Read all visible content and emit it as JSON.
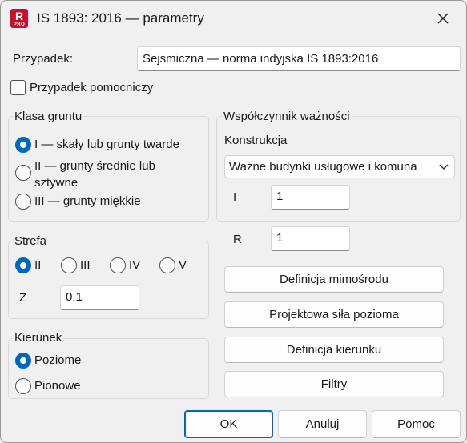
{
  "window": {
    "title": "IS 1893: 2016 — parametry",
    "app_icon_letter": "R",
    "app_icon_sub": "PRO"
  },
  "case": {
    "label": "Przypadek:",
    "value": "Sejsmiczna — norma indyjska IS 1893:2016",
    "aux_label": "Przypadek pomocniczy",
    "aux_checked": false
  },
  "soil_class": {
    "title": "Klasa gruntu",
    "options": [
      {
        "label": "I — skały lub grunty twarde",
        "selected": true
      },
      {
        "label_line1": "II — grunty średnie lub",
        "label_line2": "sztywne",
        "selected": false
      },
      {
        "label": "III — grunty miękkie",
        "selected": false
      }
    ]
  },
  "importance": {
    "title": "Współczynnik ważności",
    "construction_label": "Konstrukcja",
    "construction_value": "Ważne budynki usługowe i komuna",
    "i_label": "I",
    "i_value": "1"
  },
  "r": {
    "label": "R",
    "value": "1"
  },
  "zone": {
    "title": "Strefa",
    "options": [
      {
        "label": "II",
        "selected": true
      },
      {
        "label": "III",
        "selected": false
      },
      {
        "label": "IV",
        "selected": false
      },
      {
        "label": "V",
        "selected": false
      }
    ],
    "z_label": "Z",
    "z_value": "0,1"
  },
  "direction": {
    "title": "Kierunek",
    "options": [
      {
        "label": "Poziome",
        "selected": true
      },
      {
        "label": "Pionowe",
        "selected": false
      }
    ]
  },
  "actions": {
    "eccentricity": "Definicja mimośrodu",
    "horizontal_force": "Projektowa siła pozioma",
    "direction_def": "Definicja kierunku",
    "filters": "Filtry"
  },
  "footer": {
    "ok": "OK",
    "cancel": "Anuluj",
    "help": "Pomoc"
  },
  "colors": {
    "accent": "#0067c0",
    "app_icon": "#c8102e",
    "background": "#f0f0f0"
  }
}
